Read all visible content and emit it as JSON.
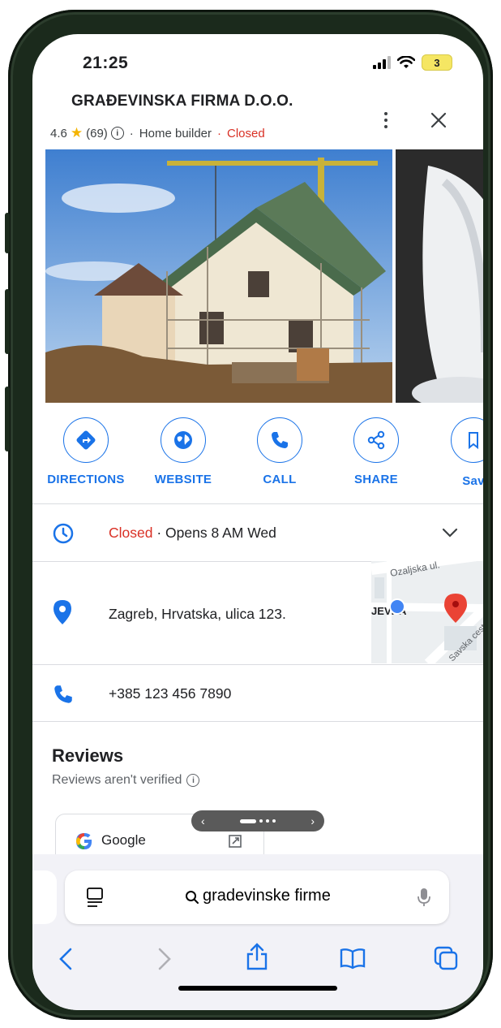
{
  "status": {
    "time": "21:25",
    "battery": "3"
  },
  "place": {
    "name": "GRAĐEVINSKA FIRMA D.O.O.",
    "rating": "4.6",
    "review_count": "(69)",
    "separator": "·",
    "category": "Home builder",
    "status": "Closed"
  },
  "actions": [
    {
      "label": "DIRECTIONS",
      "icon": "directions-icon"
    },
    {
      "label": "WEBSITE",
      "icon": "globe-icon"
    },
    {
      "label": "CALL",
      "icon": "phone-icon"
    },
    {
      "label": "SHARE",
      "icon": "share-icon"
    },
    {
      "label": "Sav",
      "icon": "bookmark-icon"
    }
  ],
  "hours": {
    "status": "Closed",
    "detail": " · Opens 8 AM Wed"
  },
  "address": {
    "text": "Zagreb, Hrvatska, ulica 123."
  },
  "map": {
    "street1": "Ozaljska ul.",
    "street2": "ŠNJEVKA",
    "street3": "Savska cesta"
  },
  "phone": {
    "text": "+385 123 456 7890"
  },
  "reviews": {
    "title": "Reviews",
    "subtitle": "Reviews aren't verified"
  },
  "google_card": {
    "label": "Google"
  },
  "browser": {
    "search_text": "gradevinske firme"
  },
  "colors": {
    "accent": "#1a73e8",
    "closed": "#d93025",
    "star": "#f4b400",
    "frame": "#1b2a1c"
  }
}
